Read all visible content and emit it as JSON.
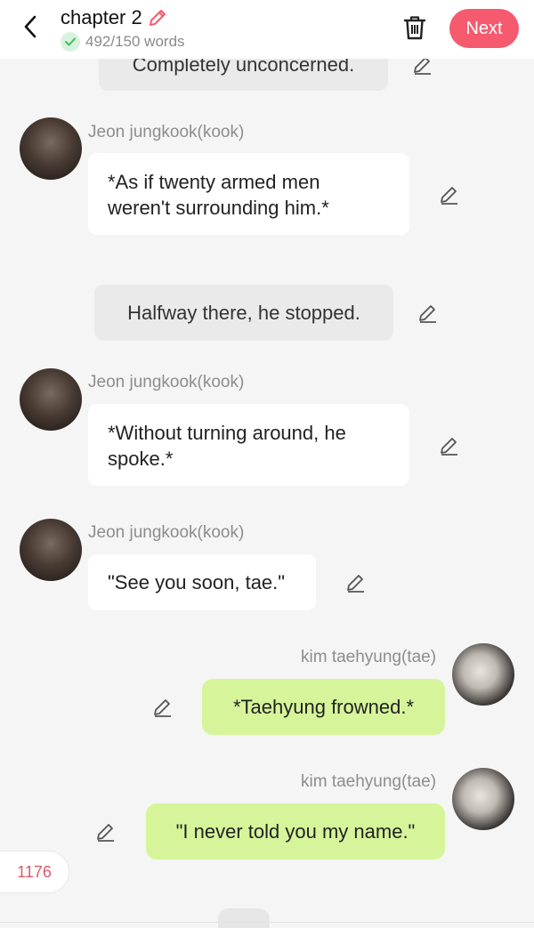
{
  "header": {
    "title": "chapter 2",
    "word_count": "492/150 words",
    "next_label": "Next"
  },
  "messages": {
    "narr_top": "Completely unconcerned.",
    "kook_name": "Jeon jungkook(kook)",
    "kook_msg1_line1": "*As if twenty armed men",
    "kook_msg1_line2": "weren't surrounding him.*",
    "narr_mid": "Halfway there, he stopped.",
    "kook_msg2_line1": "*Without turning around, he",
    "kook_msg2_line2": "spoke.*",
    "kook_msg3": "\"See you soon, tae.\"",
    "tae_name": "kim taehyung(tae)",
    "tae_msg1": "*Taehyung frowned.*",
    "tae_msg2": "\"I never told you my name.\""
  },
  "counter": "1176",
  "colors": {
    "accent": "#f55a6e",
    "tae_bubble": "#d6f59a",
    "narration_bubble": "#eaeaea",
    "check_green": "#3cbf5a"
  },
  "icons": {
    "back": "chevron-left-icon",
    "edit": "pencil-icon",
    "check": "check-icon",
    "trash": "trash-icon"
  }
}
